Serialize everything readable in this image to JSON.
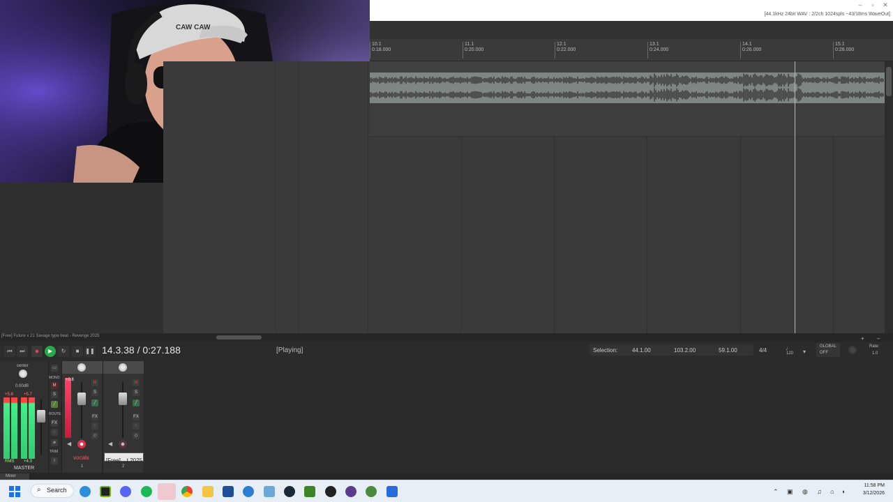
{
  "window": {
    "audio_info": "[44.1kHz 24bit WAV : 2/2ch 1024spls ~43/18ms WaveOut]",
    "minimize": "–",
    "maximize": "▫",
    "close": "✕"
  },
  "ruler": {
    "markers": [
      {
        "bar": "10.1",
        "time": "0:18.000"
      },
      {
        "bar": "11.1",
        "time": "0:20.000"
      },
      {
        "bar": "12.1",
        "time": "0:22.000"
      },
      {
        "bar": "13.1",
        "time": "0:24.000"
      },
      {
        "bar": "14.1",
        "time": "0:26.000"
      },
      {
        "bar": "15.1",
        "time": "0:28.000"
      }
    ]
  },
  "project": {
    "name": "[Free] Future x 21 Savage type beat - Revenge 2025"
  },
  "transport": {
    "timecode": "14.3.38 / 0:27.188",
    "status": "[Playing]",
    "selection_label": "Selection:",
    "selection_start": "44.1.00",
    "selection_end": "103.2.00",
    "selection_length": "59.1.00",
    "time_signature": "4/4",
    "tempo": "120",
    "global_label": "GLOBAL",
    "global_state": "OFF",
    "rate_label": "Rate:",
    "rate_value": "1.0"
  },
  "mixer": {
    "master": {
      "pan_label": "center",
      "volume_db": "0.00dB",
      "peak_left": "+5.8",
      "peak_right": "+5.7",
      "rms_label": "RMS",
      "rms_value": "+4.3",
      "name": "MASTER",
      "mono_label": "MONO",
      "route_label": "ROUTE",
      "trim_label": "TRIM",
      "fx_label": "FX"
    },
    "tracks": [
      {
        "name": "vocals",
        "number": "1",
        "peak": "+0.8"
      },
      {
        "name": "[Free] ...t 2025",
        "number": "2",
        "peak": ""
      }
    ],
    "mute_label": "M",
    "solo_label": "S",
    "fx_label": "FX",
    "tab_label": "Mixer"
  },
  "taskbar": {
    "search_label": "Search",
    "time": "11:58 PM",
    "date": "3/12/2026"
  },
  "colors": {
    "accent_play": "#27a84a",
    "record": "#e0405a",
    "cursor": "#d8c040",
    "meter_green": "#44ee88",
    "meter_red": "#ff4444"
  }
}
